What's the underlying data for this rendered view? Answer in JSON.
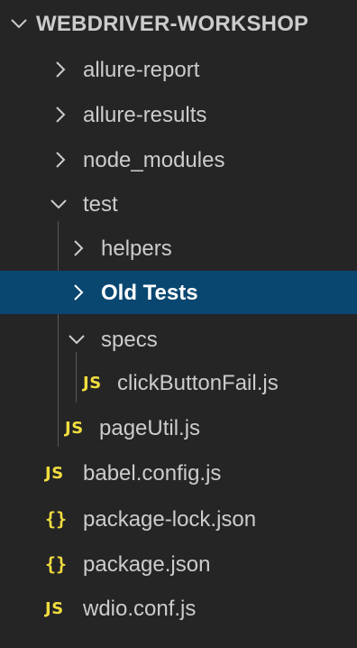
{
  "explorer": {
    "section_title": "WEBDRIVER-WORKSHOP",
    "colors": {
      "background": "#252526",
      "selected_background": "#094771",
      "text": "#cccccc",
      "js_icon": "#f1dd3f",
      "json_icon": "#f1dd3f"
    },
    "items": [
      {
        "label": "allure-report",
        "type": "folder",
        "expanded": false,
        "depth": 0
      },
      {
        "label": "allure-results",
        "type": "folder",
        "expanded": false,
        "depth": 0
      },
      {
        "label": "node_modules",
        "type": "folder",
        "expanded": false,
        "depth": 0
      },
      {
        "label": "test",
        "type": "folder",
        "expanded": true,
        "depth": 0
      },
      {
        "label": "helpers",
        "type": "folder",
        "expanded": false,
        "depth": 1
      },
      {
        "label": "Old Tests",
        "type": "folder",
        "expanded": false,
        "depth": 1,
        "selected": true
      },
      {
        "label": "specs",
        "type": "folder",
        "expanded": true,
        "depth": 1
      },
      {
        "label": "clickButtonFail.js",
        "type": "js",
        "icon_text": "JS",
        "depth": 2
      },
      {
        "label": "pageUtil.js",
        "type": "js",
        "icon_text": "JS",
        "depth": 1
      },
      {
        "label": "babel.config.js",
        "type": "js",
        "icon_text": "JS",
        "depth": 0
      },
      {
        "label": "package-lock.json",
        "type": "json",
        "icon_text": "{}",
        "depth": 0
      },
      {
        "label": "package.json",
        "type": "json",
        "icon_text": "{}",
        "depth": 0
      },
      {
        "label": "wdio.conf.js",
        "type": "js",
        "icon_text": "JS",
        "depth": 0
      }
    ]
  }
}
